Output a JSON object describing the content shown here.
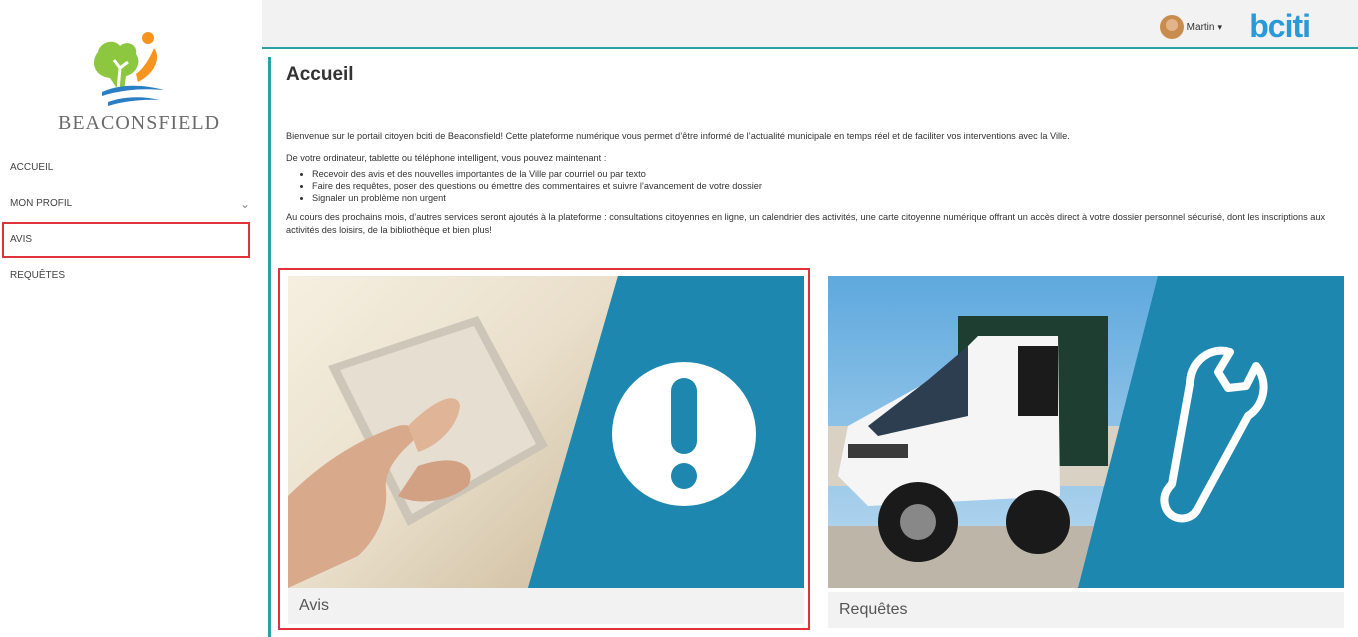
{
  "sidebar": {
    "logo_text": "BEACONSFIELD",
    "items": [
      {
        "label": "ACCUEIL"
      },
      {
        "label": "MON PROFIL"
      },
      {
        "label": "AVIS"
      },
      {
        "label": "REQUÊTES"
      }
    ]
  },
  "header": {
    "user_name": "Martin",
    "brand": "bciti"
  },
  "main": {
    "title": "Accueil",
    "intro_1": "Bienvenue sur le portail citoyen bciti de Beaconsfield! Cette plateforme numérique vous permet d’être informé de l’actualité municipale en temps réel et de faciliter vos interventions avec la Ville.",
    "intro_2": "De votre ordinateur, tablette ou téléphone intelligent, vous pouvez maintenant :",
    "bullets": [
      "Recevoir des avis et des nouvelles importantes de la Ville par courriel ou par texto",
      "Faire des requêtes, poser des questions ou émettre des commentaires et suivre l’avancement de votre dossier",
      "Signaler un problème non urgent"
    ],
    "intro_3": "Au cours des prochains mois, d’autres services seront ajoutés à la plateforme : consultations citoyennes en ligne, un calendrier des activités, une carte citoyenne numérique offrant un accès direct à votre dossier personnel sécurisé, dont les inscriptions aux activités des loisirs, de la bibliothèque et bien plus!",
    "cards": [
      {
        "label": "Avis",
        "icon": "exclamation-icon"
      },
      {
        "label": "Requêtes",
        "icon": "wrench-icon"
      }
    ]
  },
  "colors": {
    "accent": "#2aa1a3",
    "card_blue": "#1e87b0",
    "highlight": "#e0323a",
    "brand": "#2a9ad6"
  }
}
